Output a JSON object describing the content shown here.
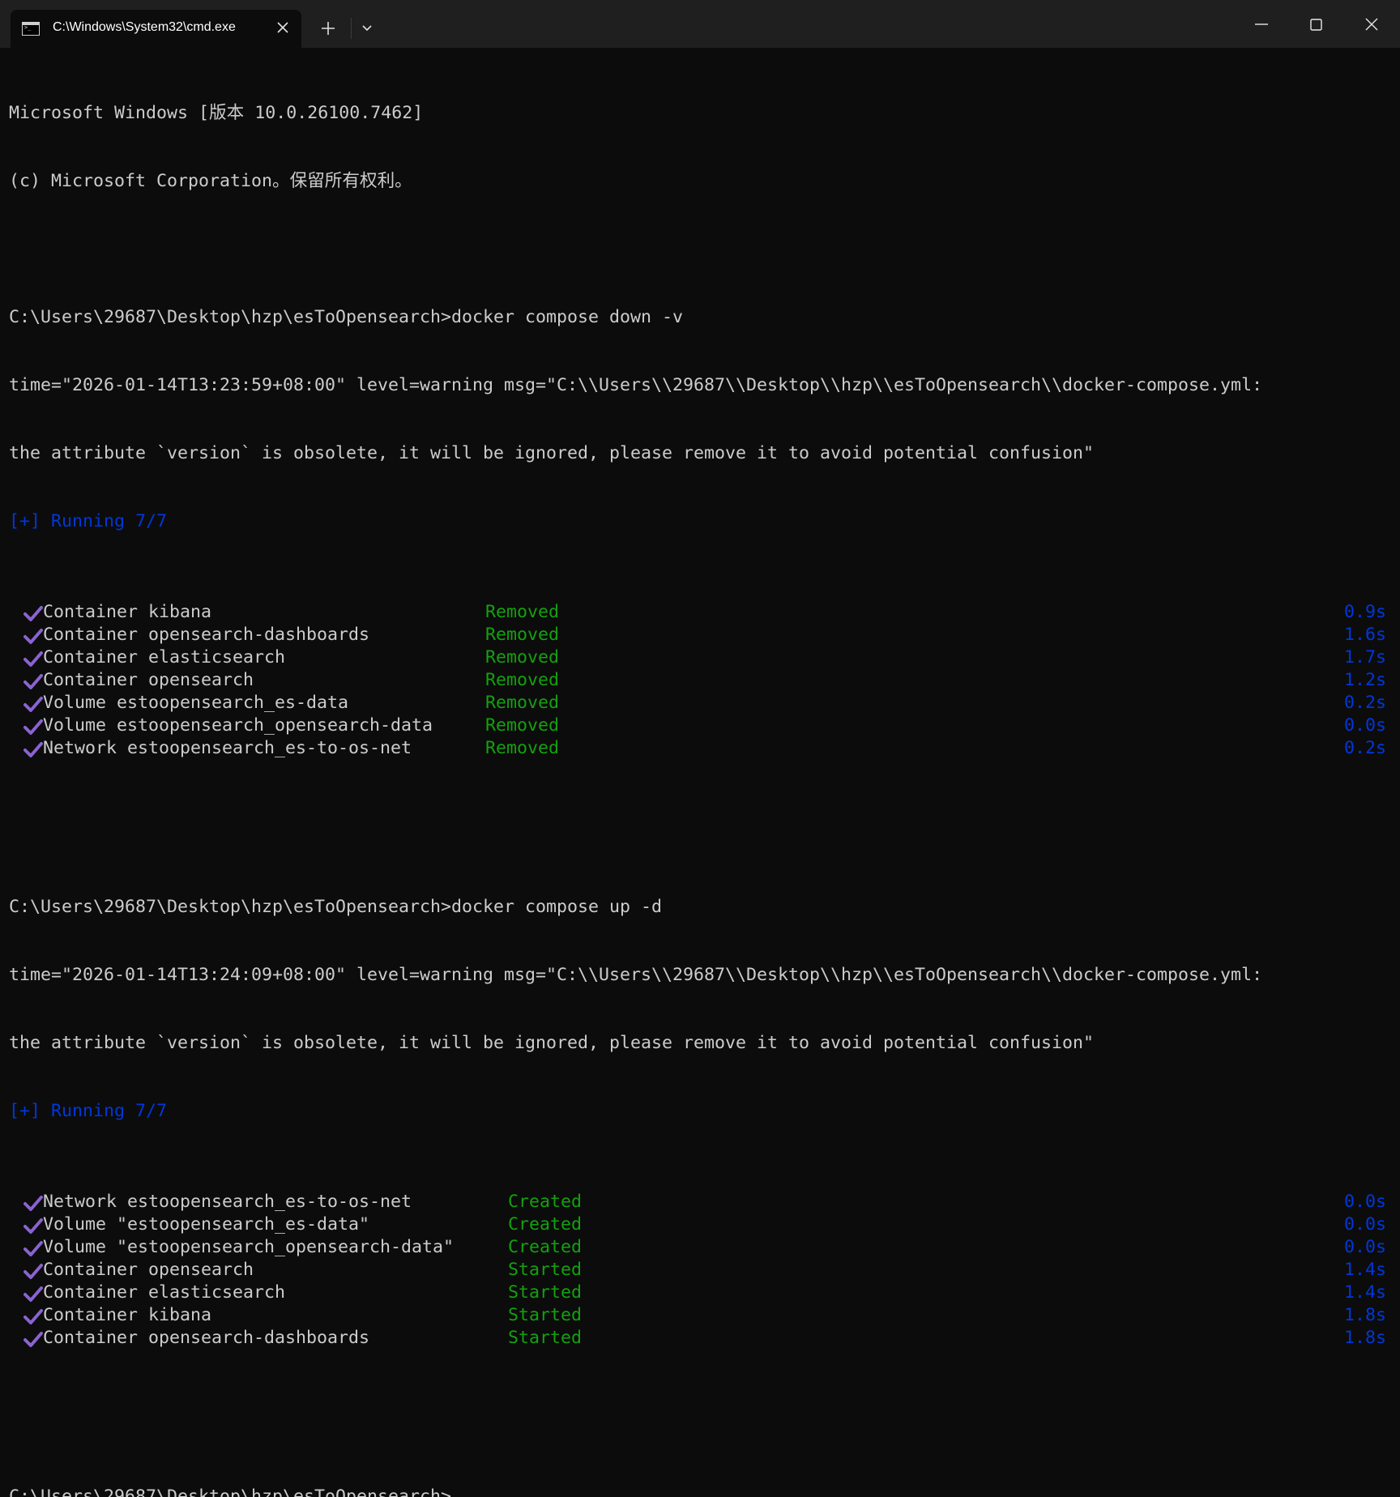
{
  "window": {
    "tab_title": "C:\\Windows\\System32\\cmd.exe",
    "accent_text": "#ffffff",
    "background": "#0c0c0c"
  },
  "icons": {
    "tab_icon": "terminal-icon",
    "close": "close-icon",
    "new_tab": "plus-icon",
    "dropdown": "chevron-down-icon",
    "minimize": "minimize-icon",
    "maximize": "maximize-icon",
    "window_close": "close-icon",
    "check": "checkmark-icon"
  },
  "colors": {
    "default_text": "#cccccc",
    "blue": "#0037da",
    "green": "#13a10e",
    "check": "#8a63d2"
  },
  "terminal": {
    "header1": "Microsoft Windows [版本 10.0.26100.7462]",
    "header2": "(c) Microsoft Corporation。保留所有权利。",
    "cmd1": "C:\\Users\\29687\\Desktop\\hzp\\esToOpensearch>docker compose down -v",
    "warn1a": "time=\"2026-01-14T13:23:59+08:00\" level=warning msg=\"C:\\\\Users\\\\29687\\\\Desktop\\\\hzp\\\\esToOpensearch\\\\docker-compose.yml:",
    "warn1b": "the attribute `version` is obsolete, it will be ignored, please remove it to avoid potential confusion\"",
    "running1": "[+] Running 7/7",
    "down_items": [
      {
        "label": "Container kibana",
        "status": "Removed",
        "time": "0.9s"
      },
      {
        "label": "Container opensearch-dashboards",
        "status": "Removed",
        "time": "1.6s"
      },
      {
        "label": "Container elasticsearch",
        "status": "Removed",
        "time": "1.7s"
      },
      {
        "label": "Container opensearch",
        "status": "Removed",
        "time": "1.2s"
      },
      {
        "label": "Volume estoopensearch_es-data",
        "status": "Removed",
        "time": "0.2s"
      },
      {
        "label": "Volume estoopensearch_opensearch-data",
        "status": "Removed",
        "time": "0.0s"
      },
      {
        "label": "Network estoopensearch_es-to-os-net",
        "status": "Removed",
        "time": "0.2s"
      }
    ],
    "cmd2": "C:\\Users\\29687\\Desktop\\hzp\\esToOpensearch>docker compose up -d",
    "warn2a": "time=\"2026-01-14T13:24:09+08:00\" level=warning msg=\"C:\\\\Users\\\\29687\\\\Desktop\\\\hzp\\\\esToOpensearch\\\\docker-compose.yml:",
    "warn2b": "the attribute `version` is obsolete, it will be ignored, please remove it to avoid potential confusion\"",
    "running2": "[+] Running 7/7",
    "up_items": [
      {
        "label": "Network estoopensearch_es-to-os-net",
        "status": "Created",
        "time": "0.0s"
      },
      {
        "label": "Volume \"estoopensearch_es-data\"",
        "status": "Created",
        "time": "0.0s"
      },
      {
        "label": "Volume \"estoopensearch_opensearch-data\"",
        "status": "Created",
        "time": "0.0s"
      },
      {
        "label": "Container opensearch",
        "status": "Started",
        "time": "1.4s"
      },
      {
        "label": "Container elasticsearch",
        "status": "Started",
        "time": "1.4s"
      },
      {
        "label": "Container kibana",
        "status": "Started",
        "time": "1.8s"
      },
      {
        "label": "Container opensearch-dashboards",
        "status": "Started",
        "time": "1.8s"
      }
    ],
    "prompt": "C:\\Users\\29687\\Desktop\\hzp\\esToOpensearch>"
  }
}
